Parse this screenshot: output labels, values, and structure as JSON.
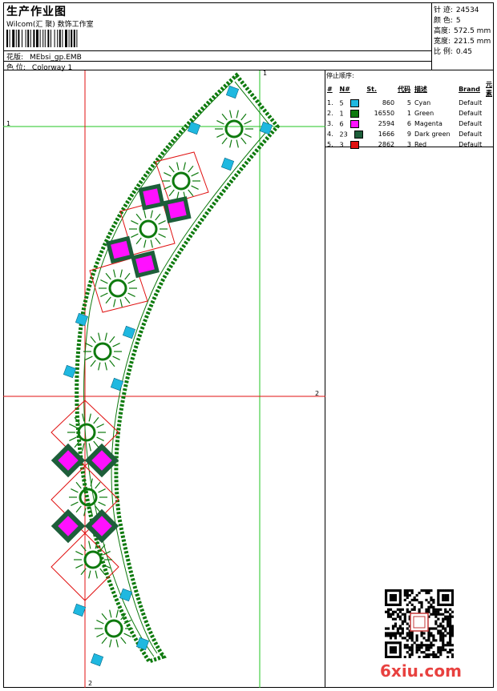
{
  "header": {
    "title": "生产作业图",
    "studio": "Wilcom(汇 聚) 数饰工作室",
    "design_label": "花版:",
    "design_value": "MEbsi_gp.EMB",
    "colorway_label": "色 位:",
    "colorway_value": "Colorway 1"
  },
  "stats": [
    {
      "label": "针 迹:",
      "value": "24534"
    },
    {
      "label": "颜 色:",
      "value": "5"
    },
    {
      "label": "高度:",
      "value": "572.5 mm"
    },
    {
      "label": "宽度:",
      "value": "221.5 mm"
    },
    {
      "label": "比 例:",
      "value": "0.45"
    }
  ],
  "stop_sequence": {
    "title": "停止顺序:",
    "headers": [
      "#",
      "N#",
      "St.",
      "代码",
      "描述",
      "Brand",
      "元素"
    ],
    "rows": [
      {
        "idx": "1.",
        "n": "5",
        "color": "#1fb8e0",
        "st": "860",
        "code": "5",
        "desc": "Cyan",
        "brand": "Default"
      },
      {
        "idx": "2.",
        "n": "1",
        "color": "#0e7a0e",
        "st": "16550",
        "code": "1",
        "desc": "Green",
        "brand": "Default"
      },
      {
        "idx": "3.",
        "n": "6",
        "color": "#ff10ff",
        "st": "2594",
        "code": "6",
        "desc": "Magenta",
        "brand": "Default"
      },
      {
        "idx": "4.",
        "n": "23",
        "color": "#1d5e3a",
        "st": "1666",
        "code": "9",
        "desc": "Dark green",
        "brand": "Default"
      },
      {
        "idx": "5.",
        "n": "3",
        "color": "#e01010",
        "st": "2862",
        "code": "3",
        "desc": "Red",
        "brand": "Default"
      }
    ]
  },
  "axis_labels": {
    "green_v": "1",
    "green_h": "1",
    "red_h": "2",
    "red_v": "2"
  },
  "watermark": "6xiu.com",
  "colors": {
    "green_line": "#22c622",
    "red_line": "#e01010",
    "cyan": "#1fb8e0",
    "green": "#0e7a0e",
    "magenta": "#ff10ff",
    "dark_green": "#1d5e3a",
    "red": "#e01010"
  }
}
